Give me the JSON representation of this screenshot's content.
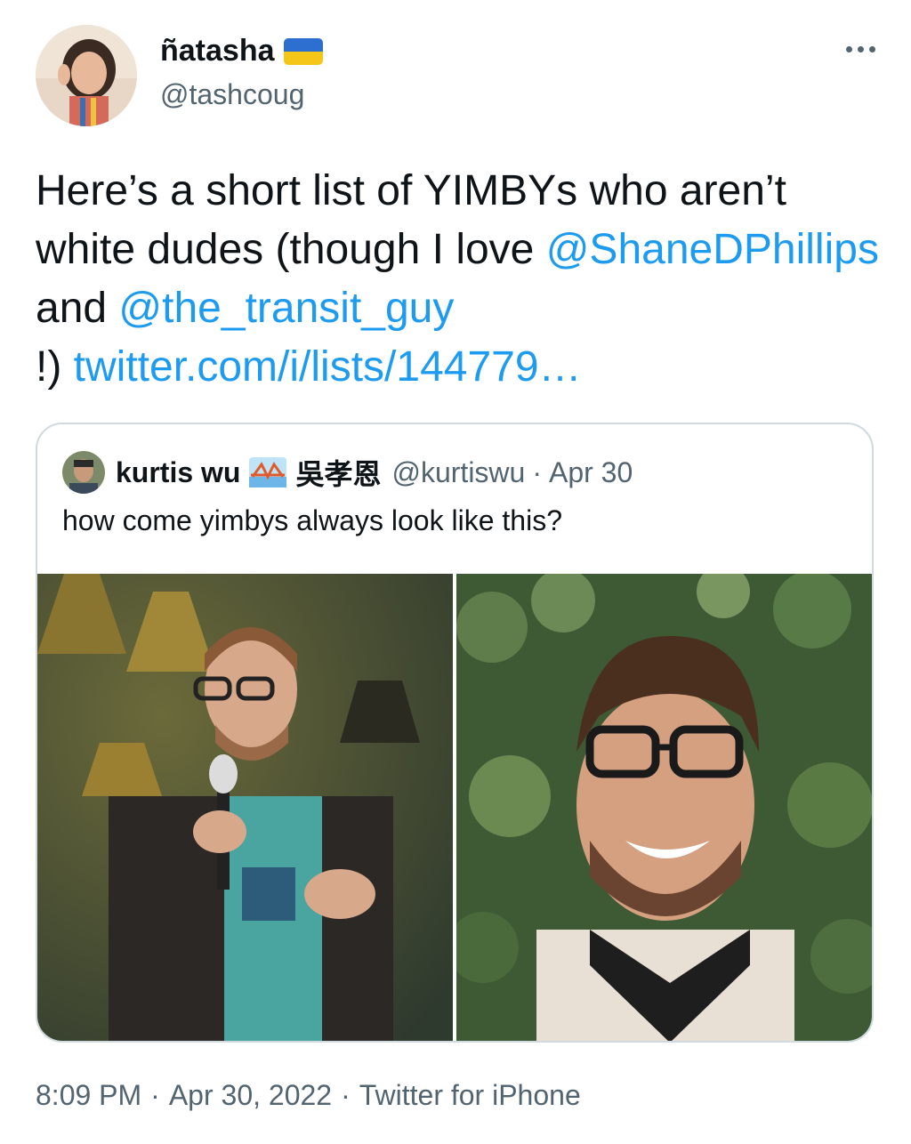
{
  "author": {
    "display_name": "ñatasha",
    "handle": "@tashcoug",
    "flag_icon": "ukraine-flag-icon"
  },
  "tweet": {
    "text_1": "Here’s a short list of YIMBYs who aren’t white dudes (though I love ",
    "mention_1": "@ShaneDPhillips",
    "text_2": " and ",
    "mention_2": "@the_transit_guy",
    "text_3": " !) ",
    "link": "twitter.com/i/lists/144779…"
  },
  "quoted_tweet": {
    "display_name": "kurtis wu",
    "emoji_icon": "bridge-at-sunrise-icon",
    "name_cjk": "吳孝恩",
    "handle": "@kurtiswu",
    "date": "Apr 30",
    "separator": "·",
    "text": "how come yimbys always look like this?"
  },
  "footer": {
    "time": "8:09 PM",
    "date": "Apr 30, 2022",
    "source": "Twitter for iPhone",
    "separator": "·"
  },
  "colors": {
    "link": "#1d9bf0",
    "secondary_text": "#536471",
    "border": "#cfd9de"
  }
}
